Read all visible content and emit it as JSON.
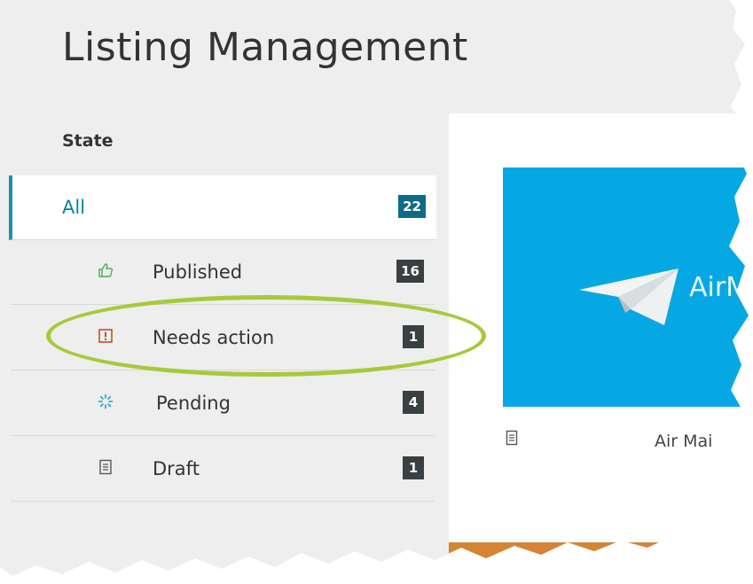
{
  "page": {
    "title": "Listing Management"
  },
  "filter_panel": {
    "header": "State",
    "items": [
      {
        "label": "All",
        "count": "22",
        "icon": "none",
        "selected": true
      },
      {
        "label": "Published",
        "count": "16",
        "icon": "thumbs-up-icon"
      },
      {
        "label": "Needs action",
        "count": "1",
        "icon": "alert-icon"
      },
      {
        "label": "Pending",
        "count": "4",
        "icon": "spinner-icon"
      },
      {
        "label": "Draft",
        "count": "1",
        "icon": "document-icon"
      }
    ]
  },
  "listing_card": {
    "image_text": "AirM",
    "name": "Air Mai",
    "image_color": "#06a8e4",
    "file_icon": "document-icon"
  },
  "colors": {
    "accent": "#1a8fb3",
    "badge": "#3a3f42",
    "highlight": "#a8c93a",
    "alert": "#c0502a"
  }
}
